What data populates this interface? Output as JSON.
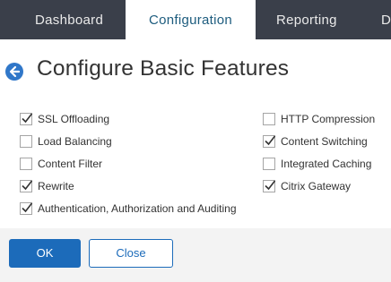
{
  "nav": {
    "tabs": [
      {
        "label": "Dashboard",
        "active": false
      },
      {
        "label": "Configuration",
        "active": true
      },
      {
        "label": "Reporting",
        "active": false
      },
      {
        "label": "D",
        "active": false
      }
    ]
  },
  "page": {
    "title": "Configure Basic Features",
    "back_icon": "arrow-left-circle-icon"
  },
  "features": {
    "left": [
      {
        "label": "SSL Offloading",
        "checked": true
      },
      {
        "label": "Load Balancing",
        "checked": false
      },
      {
        "label": "Content Filter",
        "checked": false
      },
      {
        "label": "Rewrite",
        "checked": true
      },
      {
        "label": "Authentication, Authorization and Auditing",
        "checked": true
      }
    ],
    "right": [
      {
        "label": "HTTP Compression",
        "checked": false
      },
      {
        "label": "Content Switching",
        "checked": true
      },
      {
        "label": "Integrated Caching",
        "checked": false
      },
      {
        "label": "Citrix Gateway",
        "checked": true
      }
    ]
  },
  "actions": {
    "ok_label": "OK",
    "close_label": "Close"
  },
  "colors": {
    "nav_bg": "#3a3f4a",
    "accent": "#1c6bba",
    "active_tab_text": "#1d5c7e"
  }
}
